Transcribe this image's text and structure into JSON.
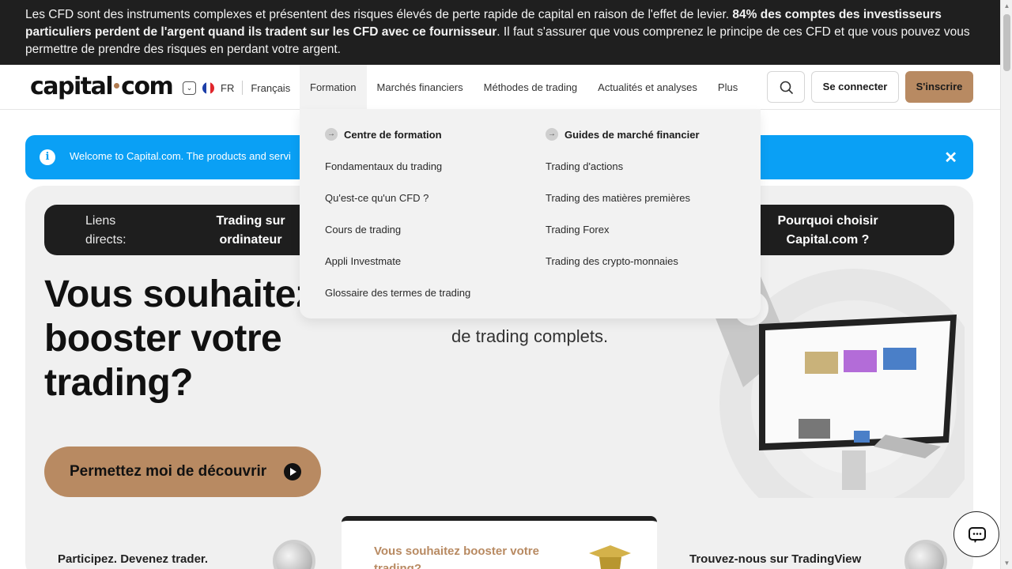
{
  "risk_banner": {
    "text_pre": "Les CFD sont des instruments complexes et présentent des risques élevés de perte rapide de capital en raison de l'effet de levier. ",
    "text_bold": "84% des comptes des investisseurs particuliers perdent de l'argent quand ils tradent sur les CFD avec ce fournisseur",
    "text_post": ". Il faut s'assurer que vous comprenez le principe de ces CFD et que vous pouvez vous permettre de prendre des risques en perdant votre argent."
  },
  "header": {
    "logo_left": "capital",
    "logo_right": "com",
    "lang_code": "FR",
    "lang_name": "Français",
    "nav": [
      "Formation",
      "Marchés financiers",
      "Méthodes de trading",
      "Actualités et analyses",
      "Plus"
    ],
    "login": "Se connecter",
    "signup": "S'inscrire"
  },
  "welcome": {
    "text": "Welcome to Capital.com. The products and servi",
    "info_icon": "i",
    "close_icon": "✕"
  },
  "quick_links": {
    "label": "Liens directs:",
    "link1": "Trading sur ordinateur",
    "link2": "Pourquoi choisir Capital.com ?"
  },
  "hero": {
    "title": "Vous souhaitez booster votre trading?",
    "subtitle": "de trading complets.",
    "cta": "Permettez moi de découvrir"
  },
  "bottom": {
    "card1": "Participez. Devenez trader.",
    "card2": "Vous souhaitez booster votre trading?",
    "card3": "Trouvez-nous sur TradingView"
  },
  "dropdown": {
    "col1_title": "Centre de formation",
    "col1_items": [
      "Fondamentaux du trading",
      "Qu'est-ce qu'un CFD ?",
      "Cours de trading",
      "Appli Investmate",
      "Glossaire des termes de trading"
    ],
    "col2_title": "Guides de marché financier",
    "col2_items": [
      "Trading d'actions",
      "Trading des matières premières",
      "Trading Forex",
      "Trading des crypto-monnaies"
    ]
  },
  "colors": {
    "accent": "#b88a62",
    "info_blue": "#0aa0f5",
    "dark": "#1e1e1e"
  }
}
